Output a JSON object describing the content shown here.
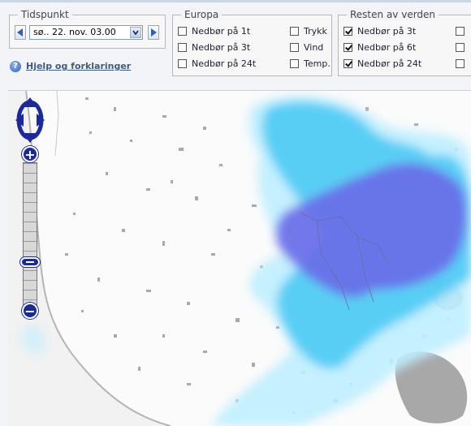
{
  "tidspunkt": {
    "legend": "Tidspunkt",
    "selected_time": "sø.. 22. nov. 03.00"
  },
  "europa": {
    "legend": "Europa",
    "options": [
      {
        "label": "Nedbør på 1t",
        "checked": false
      },
      {
        "label": "Nedbør på 3t",
        "checked": false
      },
      {
        "label": "Nedbør på 24t",
        "checked": false
      },
      {
        "label": "Trykk",
        "checked": false
      },
      {
        "label": "Vind",
        "checked": false
      },
      {
        "label": "Temp.",
        "checked": false
      }
    ]
  },
  "resten": {
    "legend": "Resten av verden",
    "options": [
      {
        "label": "Nedbør på 3t",
        "checked": true
      },
      {
        "label": "Nedbør på 6t",
        "checked": true
      },
      {
        "label": "Nedbør på 24t",
        "checked": true
      }
    ]
  },
  "help": {
    "link_text": "Hjelp og forklaringer",
    "icon": "help-icon"
  },
  "map": {
    "icons": [
      "pan-control-icon",
      "zoom-in-icon",
      "zoom-out-icon",
      "zoom-slider-handle"
    ],
    "colors": {
      "land": "#fbfbfb",
      "lakes": "#a8a8a8",
      "precip_light": "#bfeeff",
      "precip_medium": "#3fc6f2",
      "precip_heavy": "#6a6ae8",
      "control": "#1a2a9a"
    }
  }
}
